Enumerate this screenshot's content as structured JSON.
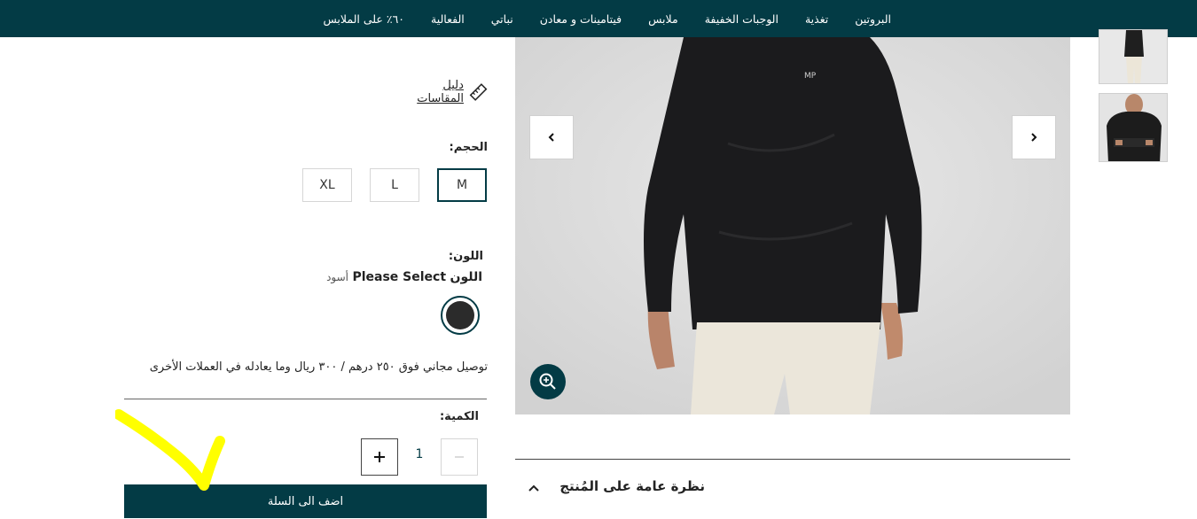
{
  "nav": {
    "items": [
      {
        "label": "البروتين"
      },
      {
        "label": "تغذية"
      },
      {
        "label": "الوجبات الخفيفة"
      },
      {
        "label": "ملابس"
      },
      {
        "label": "فيتامينات و معادن"
      },
      {
        "label": "نباتي"
      },
      {
        "label": "الفعالية"
      },
      {
        "label": "٦٠٪ على الملابس"
      }
    ]
  },
  "product": {
    "size_guide_label": "دليل المقاسات",
    "size_label": "الحجم:",
    "sizes": [
      {
        "label": "M",
        "selected": true
      },
      {
        "label": "L",
        "selected": false
      },
      {
        "label": "XL",
        "selected": false
      }
    ],
    "color_label": "اللون:",
    "color_prefix": "اللون",
    "color_select": "Please Select",
    "color_value": "أسود",
    "swatch_color": "#2b2b2b",
    "shipping_note": "توصيل مجاني فوق ٢٥٠ درهم / ٣٠٠ ريال وما يعادله في العملات الأخرى",
    "quantity_label": "الكمية:",
    "quantity": "1",
    "add_to_cart_label": "اضف الى السلة",
    "overview_title": "نظرة عامة على المُنتج"
  },
  "gallery": {
    "logo_text": "MP"
  },
  "colors": {
    "brand": "#033b45",
    "highlight": "#ffff00"
  }
}
